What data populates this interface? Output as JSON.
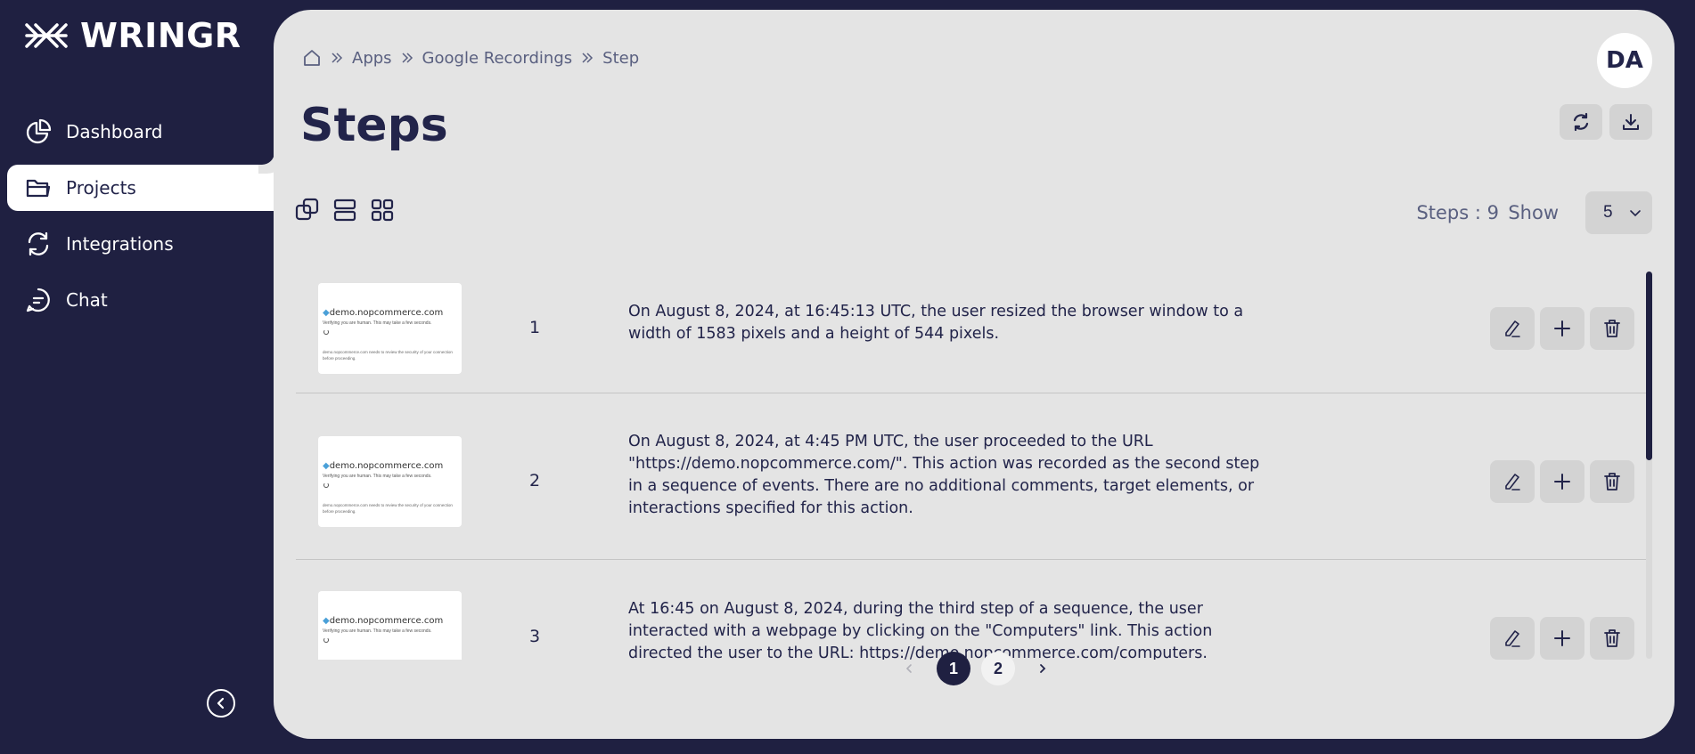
{
  "app": {
    "name": "WRINGR"
  },
  "sidebar": {
    "items": [
      {
        "label": "Dashboard",
        "icon": "pie-chart-icon"
      },
      {
        "label": "Projects",
        "icon": "folder-icon",
        "active": true
      },
      {
        "label": "Integrations",
        "icon": "sync-icon"
      },
      {
        "label": "Chat",
        "icon": "chat-icon"
      }
    ]
  },
  "breadcrumb": {
    "items": [
      "Apps",
      "Google Recordings",
      "Step"
    ]
  },
  "user": {
    "initials": "DA"
  },
  "page": {
    "title": "Steps"
  },
  "toolbar": {
    "steps_count": "Steps : 9",
    "show_label": "Show",
    "show_value": "5"
  },
  "steps": [
    {
      "number": "1",
      "description": "On August 8, 2024, at 16:45:13 UTC, the user resized the browser window to a width of 1583 pixels and a height of 544 pixels.",
      "thumb": {
        "site": "demo.nopcommerce.com",
        "line2": "Verifying you are human. This may take a few seconds.",
        "line3": "demo.nopcommerce.com needs to review the security of your connection before proceeding."
      }
    },
    {
      "number": "2",
      "description": "On August 8, 2024, at 4:45 PM UTC, the user proceeded to the URL \"https://demo.nopcommerce.com/\". This action was recorded as the second step in a sequence of events. There are no additional comments, target elements, or interactions specified for this action.",
      "thumb": {
        "site": "demo.nopcommerce.com",
        "line2": "Verifying you are human. This may take a few seconds.",
        "line3": "demo.nopcommerce.com needs to review the security of your connection before proceeding."
      }
    },
    {
      "number": "3",
      "description": "At 16:45 on August 8, 2024, during the third step of a sequence, the user interacted with a webpage by clicking on the \"Computers\" link. This action directed the user to the URL: https://demo.nopcommerce.com/computers.",
      "thumb": {
        "site": "demo.nopcommerce.com",
        "line2": "Verifying you are human. This may take a few seconds.",
        "line3": ""
      }
    }
  ],
  "pagination": {
    "pages": [
      "1",
      "2"
    ],
    "current": "1"
  },
  "colors": {
    "sidebar_bg": "#1f2041",
    "main_bg": "#e4e4e4",
    "button_bg": "#d3d3d3",
    "accent": "#1f2041"
  }
}
